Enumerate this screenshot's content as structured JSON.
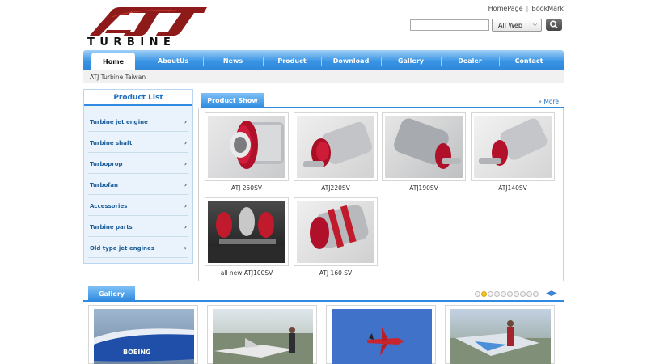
{
  "header": {
    "logo_text": "TURBINE",
    "logo_mark": "ATJ",
    "links": [
      "HomePage",
      "BookMark"
    ],
    "search": {
      "placeholder": "",
      "scope": "All Web"
    }
  },
  "nav": {
    "items": [
      "Home",
      "AboutUs",
      "News",
      "Product",
      "Download",
      "Gallery",
      "Dealer",
      "Contact"
    ],
    "active": "Home"
  },
  "breadcrumb": "ATJ Turbine Taiwan",
  "product_list": {
    "title": "Product List",
    "items": [
      "Turbine jet engine",
      "Turbine shaft",
      "Turboprop",
      "Turbofan",
      "Accessories",
      "Turbine parts",
      "Old type jet engines"
    ]
  },
  "product_show": {
    "title": "Product Show",
    "more": "More",
    "products": [
      {
        "caption": "ATJ 250SV",
        "icon": "turbine-photo"
      },
      {
        "caption": "ATJ220SV",
        "icon": "turbine-photo"
      },
      {
        "caption": "ATJ190SV",
        "icon": "turbine-photo"
      },
      {
        "caption": "ATJ140SV",
        "icon": "turbine-photo"
      },
      {
        "caption": "all new ATJ100SV",
        "icon": "turbine-photo"
      },
      {
        "caption": "ATJ 160 SV",
        "icon": "turbine-photo"
      }
    ]
  },
  "gallery": {
    "title": "Gallery",
    "photos": [
      "boeing-plane-photo",
      "jet-model-photo",
      "jet-in-sky-photo",
      "jet-at-show-photo"
    ]
  },
  "colors": {
    "accent": "#2f8ae0",
    "link": "#1b5d99",
    "logo_red": "#8e1a1a"
  }
}
